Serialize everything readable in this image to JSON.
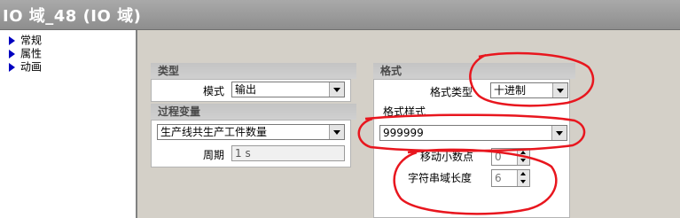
{
  "window": {
    "title": "IO 域_48 (IO 域)"
  },
  "tree": {
    "items": [
      {
        "label": "常规"
      },
      {
        "label": "属性"
      },
      {
        "label": "动画"
      }
    ]
  },
  "type_group": {
    "header": "类型",
    "mode_label": "模式",
    "mode_value": "输出"
  },
  "process_group": {
    "header": "过程变量",
    "variable_value": "生产线共生产工件数量",
    "cycle_label": "周期",
    "cycle_value": "1 s"
  },
  "format_group": {
    "header": "格式",
    "format_type_label": "格式类型",
    "format_type_value": "十进制",
    "format_pattern_label": "格式样式",
    "format_pattern_value": "999999",
    "decimal_label": "移动小数点",
    "decimal_value": "0",
    "length_label": "字符串域长度",
    "length_value": "6"
  },
  "colors": {
    "annotation": "#e8161e",
    "titlebar": "#9a9a9a",
    "tree_arrow": "#0000c0"
  }
}
